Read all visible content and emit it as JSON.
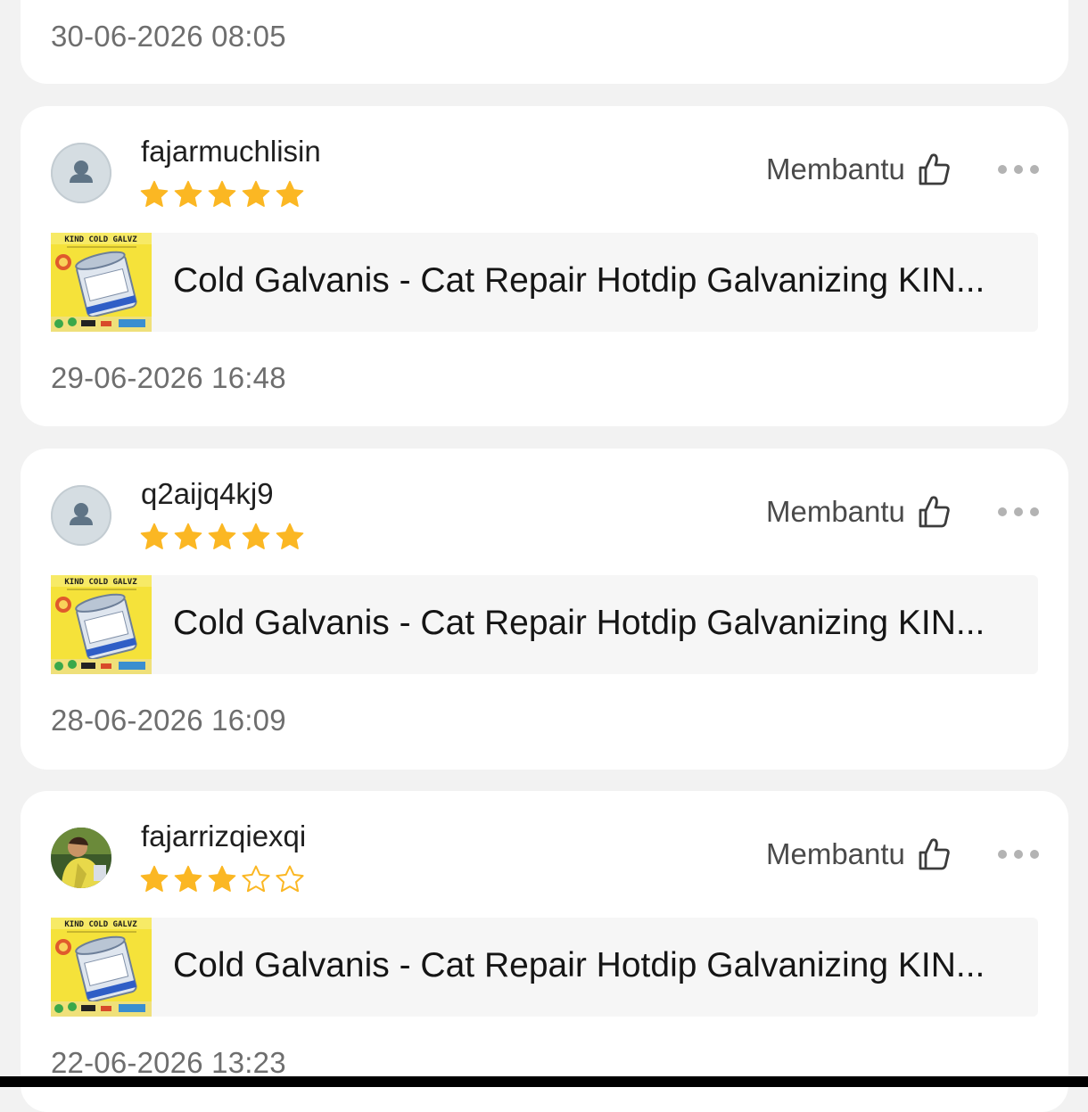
{
  "colors": {
    "star_filled": "#fbb723",
    "star_empty_stroke": "#fbb723",
    "background": "#f2f2f2",
    "card": "#ffffff"
  },
  "previous_review": {
    "date": "30-06-2026 08:05"
  },
  "reviews": [
    {
      "username": "fajarmuchlisin",
      "rating": 5,
      "avatar": "default-user-icon",
      "helpful_label": "Membantu",
      "product_title": "Cold Galvanis - Cat Repair Hotdip Galvanizing  KIN...",
      "product_image_text": "KIND COLD GALVZ",
      "date": "29-06-2026 16:48"
    },
    {
      "username": "q2aijq4kj9",
      "rating": 5,
      "avatar": "default-user-icon",
      "helpful_label": "Membantu",
      "product_title": "Cold Galvanis - Cat Repair Hotdip Galvanizing  KIN...",
      "product_image_text": "KIND COLD GALVZ",
      "date": "28-06-2026 16:09"
    },
    {
      "username": "fajarrizqiexqi",
      "rating": 3,
      "avatar": "photo-avatar",
      "helpful_label": "Membantu",
      "product_title": "Cold Galvanis - Cat Repair Hotdip Galvanizing  KIN...",
      "product_image_text": "KIND COLD GALVZ",
      "date": "22-06-2026 13:23"
    }
  ]
}
